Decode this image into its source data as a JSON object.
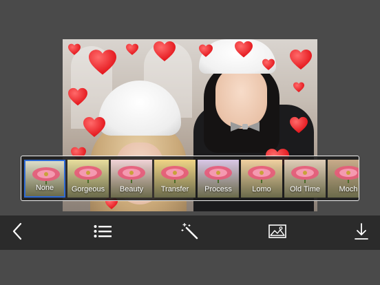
{
  "filters": [
    {
      "label": "None",
      "selected": true,
      "tint": "#dcdcc8"
    },
    {
      "label": "Gorgeous",
      "selected": false,
      "tint": "#e8dd9d"
    },
    {
      "label": "Beauty",
      "selected": false,
      "tint": "#f0d2d6"
    },
    {
      "label": "Transfer",
      "selected": false,
      "tint": "#f0d486"
    },
    {
      "label": "Process",
      "selected": false,
      "tint": "#d9c7e6"
    },
    {
      "label": "Lomo",
      "selected": false,
      "tint": "#f0d0a0"
    },
    {
      "label": "Old Time",
      "selected": false,
      "tint": "#e0cdb8"
    },
    {
      "label": "Moch",
      "selected": false,
      "tint": "#c9ab8a"
    }
  ],
  "toolbar": {
    "back": "back-chevron-icon",
    "menu": "list-menu-icon",
    "effects": "magic-wand-icon",
    "gallery": "photo-gallery-icon",
    "download": "download-icon"
  },
  "colors": {
    "accent": "#2f6bd6",
    "heart": "#e3141a",
    "toolbar_bg": "#2b2b2b",
    "background": "#4a4a4a"
  }
}
